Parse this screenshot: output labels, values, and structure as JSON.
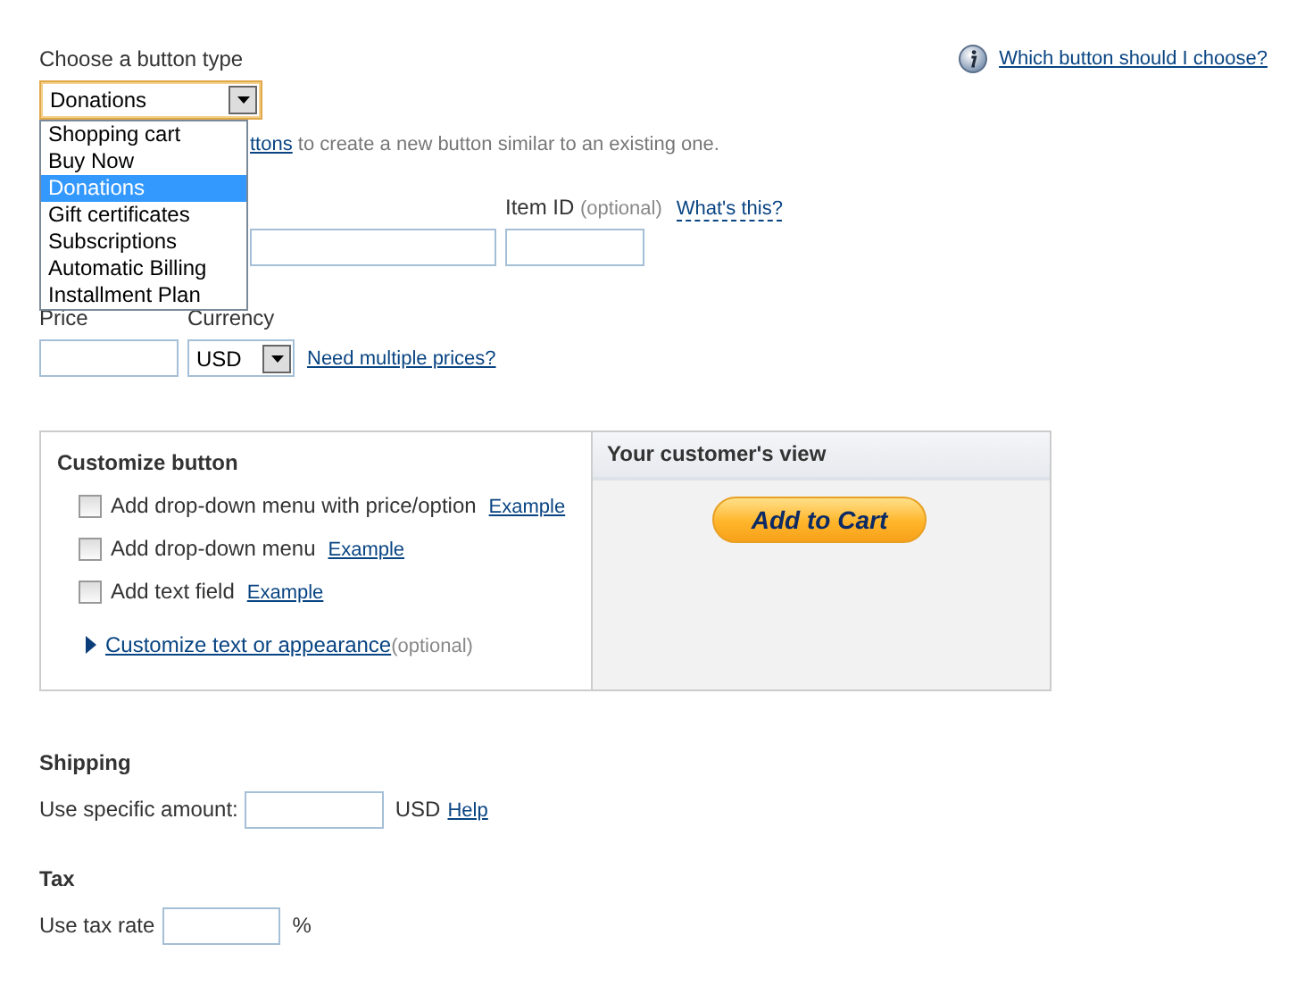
{
  "button_type": {
    "label": "Choose a button type",
    "value": "Donations",
    "expanded": true,
    "options": [
      {
        "label": "Shopping cart",
        "selected": false
      },
      {
        "label": "Buy Now",
        "selected": false
      },
      {
        "label": "Donations",
        "selected": true
      },
      {
        "label": "Gift certificates",
        "selected": false
      },
      {
        "label": "Subscriptions",
        "selected": false
      },
      {
        "label": "Automatic Billing",
        "selected": false
      },
      {
        "label": "Installment Plan",
        "selected": false
      }
    ]
  },
  "help_link": "Which button should I choose?",
  "hint": {
    "link": "ttons",
    "text": "to create a new button similar to an existing one."
  },
  "item_id": {
    "label": "Item ID",
    "note": "(optional)",
    "help": "What's this?"
  },
  "price": {
    "label": "Price"
  },
  "currency": {
    "label": "Currency",
    "value": "USD",
    "link": "Need multiple prices?"
  },
  "customize": {
    "title": "Customize button",
    "options": [
      {
        "label": "Add drop-down menu with price/option",
        "example": "Example",
        "checked": false
      },
      {
        "label": "Add drop-down menu",
        "example": "Example",
        "checked": false
      },
      {
        "label": "Add text field",
        "example": "Example",
        "checked": false
      }
    ],
    "more_link": "Customize text or appearance",
    "more_note": "(optional)",
    "expanded": false
  },
  "preview": {
    "title": "Your customer's view",
    "button": "Add to Cart"
  },
  "shipping": {
    "title": "Shipping",
    "label": "Use specific amount:",
    "unit": "USD",
    "help": "Help"
  },
  "tax": {
    "title": "Tax",
    "label": "Use tax rate",
    "unit": "%"
  }
}
